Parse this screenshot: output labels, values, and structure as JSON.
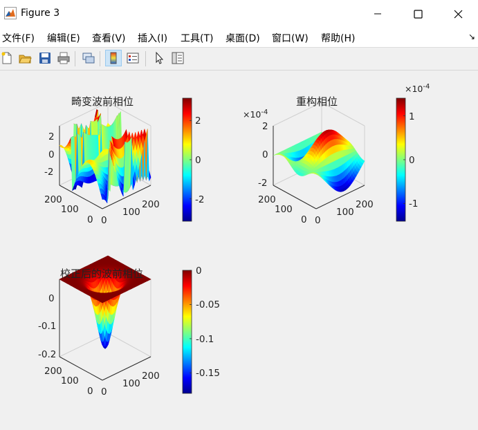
{
  "window": {
    "title": "Figure 3",
    "icon": "matlab-icon",
    "controls": [
      "minimize-icon",
      "maximize-icon",
      "close-icon"
    ]
  },
  "menu": [
    "文件(F)",
    "编辑(E)",
    "查看(V)",
    "插入(I)",
    "工具(T)",
    "桌面(D)",
    "窗口(W)",
    "帮助(H)"
  ],
  "menu_arrow": "↘",
  "toolbar": [
    "new-figure-icon",
    "open-icon",
    "save-icon",
    "print-icon",
    "link-icon",
    "colorbar-toggle-icon",
    "legend-toggle-icon",
    "pointer-icon",
    "property-editor-icon"
  ],
  "colors": {
    "window_bg": "#f0f0f0",
    "titlebar": "#ffffff",
    "toolbar_active": "#cce4f7",
    "colormap": "jet"
  },
  "chart_data": [
    {
      "type": "surface",
      "title": "畸变波前相位",
      "colormap": "jet",
      "zticks": [
        "2",
        "0",
        "-2"
      ],
      "yticks": [
        "200",
        "100",
        "0"
      ],
      "xticks": [
        "0",
        "100",
        "200"
      ],
      "colorbar": {
        "ticks": [
          "2",
          "0",
          "-2"
        ],
        "range": [
          -3.14,
          3.14
        ]
      }
    },
    {
      "type": "surface",
      "title": "重构相位",
      "colormap": "jet",
      "z_multiplier": "10",
      "z_exponent": "-4",
      "zticks": [
        "2",
        "0",
        "-2"
      ],
      "yticks": [
        "200",
        "100",
        "0"
      ],
      "xticks": [
        "0",
        "100",
        "200"
      ],
      "colorbar": {
        "multiplier": "10",
        "exponent": "-4",
        "ticks": [
          "1",
          "0",
          "-1"
        ],
        "range": [
          -1.4,
          1.4
        ]
      }
    },
    {
      "type": "surface",
      "title": "校正后的波前相位",
      "colormap": "jet",
      "zticks": [
        "0",
        "-0.1",
        "-0.2"
      ],
      "yticks": [
        "200",
        "100",
        "0"
      ],
      "xticks": [
        "0",
        "100",
        "200"
      ],
      "colorbar": {
        "ticks": [
          "0",
          "-0.05",
          "-0.1",
          "-0.15"
        ],
        "range": [
          -0.18,
          0
        ]
      }
    }
  ]
}
